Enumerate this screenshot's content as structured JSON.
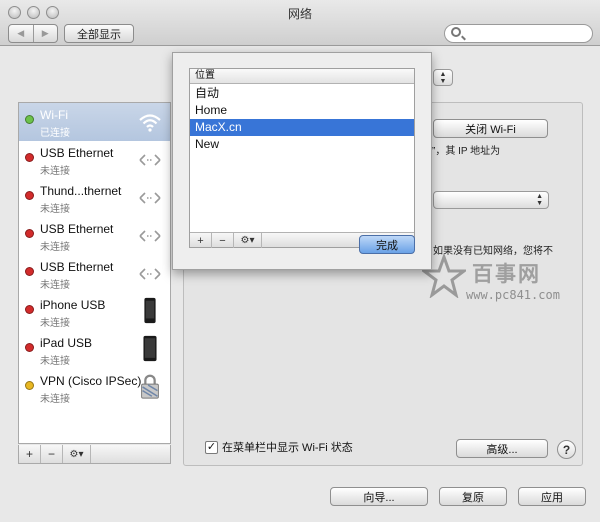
{
  "window": {
    "title": "网络"
  },
  "toolbar": {
    "back_label": "◀",
    "forward_label": "▶",
    "show_all_label": "全部显示",
    "search_placeholder": ""
  },
  "sidebar": {
    "items": [
      {
        "name": "Wi-Fi",
        "status": "已连接",
        "status_color": "#6cc24a",
        "icon": "wifi-icon",
        "selected": true
      },
      {
        "name": "USB Ethernet",
        "status": "未连接",
        "status_color": "#d22b2b",
        "icon": "ethernet-icon"
      },
      {
        "name": "Thund...thernet",
        "status": "未连接",
        "status_color": "#d22b2b",
        "icon": "ethernet-icon"
      },
      {
        "name": "USB Ethernet",
        "status": "未连接",
        "status_color": "#d22b2b",
        "icon": "ethernet-icon"
      },
      {
        "name": "USB Ethernet",
        "status": "未连接",
        "status_color": "#d22b2b",
        "icon": "ethernet-icon"
      },
      {
        "name": "iPhone USB",
        "status": "未连接",
        "status_color": "#d22b2b",
        "icon": "iphone-icon"
      },
      {
        "name": "iPad USB",
        "status": "未连接",
        "status_color": "#d22b2b",
        "icon": "ipad-icon"
      },
      {
        "name": "VPN (Cisco IPSec)",
        "status": "未连接",
        "status_color": "#e8b722",
        "icon": "lock-icon"
      }
    ],
    "add_label": "+",
    "remove_label": "−",
    "gear_label": "⚙▾"
  },
  "panel": {
    "turn_off_wifi_label": "关闭 Wi-Fi",
    "ip_text": "”，其 IP 地址为",
    "network_text": "如果没有已知网络，您将不",
    "show_wifi_menu_label": "在菜单栏中显示 Wi-Fi 状态",
    "show_wifi_menu_checked": true,
    "advanced_label": "高级...",
    "help_label": "?"
  },
  "footer": {
    "assist_label": "向导...",
    "revert_label": "复原",
    "apply_label": "应用"
  },
  "location_sheet": {
    "header": "位置",
    "locations": [
      "自动",
      "Home",
      "MacX.cn",
      "New"
    ],
    "selected_index": 2,
    "add_label": "+",
    "remove_label": "−",
    "gear_label": "⚙▾",
    "done_label": "完成"
  },
  "watermark": {
    "title": "百事网",
    "url": "www.pc841.com"
  },
  "colors": {
    "selection": "#3875d7",
    "sidebar_selection": "#b4c6df",
    "done_button": "#6aa1e6"
  }
}
